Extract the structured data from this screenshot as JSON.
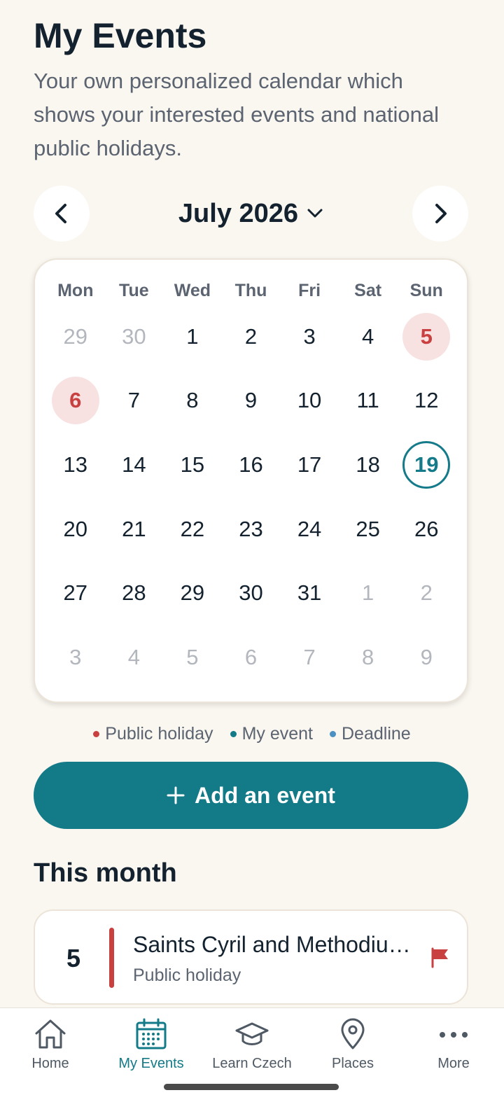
{
  "header": {
    "title": "My Events",
    "subtitle": "Your own personalized calendar which shows your interested events and national public holidays."
  },
  "calendar": {
    "month_label": "July 2026",
    "weekdays": [
      "Mon",
      "Tue",
      "Wed",
      "Thu",
      "Fri",
      "Sat",
      "Sun"
    ],
    "days": [
      {
        "label": "29",
        "state": "muted"
      },
      {
        "label": "30",
        "state": "muted"
      },
      {
        "label": "1",
        "state": ""
      },
      {
        "label": "2",
        "state": ""
      },
      {
        "label": "3",
        "state": ""
      },
      {
        "label": "4",
        "state": ""
      },
      {
        "label": "5",
        "state": "holiday"
      },
      {
        "label": "6",
        "state": "holiday"
      },
      {
        "label": "7",
        "state": ""
      },
      {
        "label": "8",
        "state": ""
      },
      {
        "label": "9",
        "state": ""
      },
      {
        "label": "10",
        "state": ""
      },
      {
        "label": "11",
        "state": ""
      },
      {
        "label": "12",
        "state": ""
      },
      {
        "label": "13",
        "state": ""
      },
      {
        "label": "14",
        "state": ""
      },
      {
        "label": "15",
        "state": ""
      },
      {
        "label": "16",
        "state": ""
      },
      {
        "label": "17",
        "state": ""
      },
      {
        "label": "18",
        "state": ""
      },
      {
        "label": "19",
        "state": "today"
      },
      {
        "label": "20",
        "state": ""
      },
      {
        "label": "21",
        "state": ""
      },
      {
        "label": "22",
        "state": ""
      },
      {
        "label": "23",
        "state": ""
      },
      {
        "label": "24",
        "state": ""
      },
      {
        "label": "25",
        "state": ""
      },
      {
        "label": "26",
        "state": ""
      },
      {
        "label": "27",
        "state": ""
      },
      {
        "label": "28",
        "state": ""
      },
      {
        "label": "29",
        "state": ""
      },
      {
        "label": "30",
        "state": ""
      },
      {
        "label": "31",
        "state": ""
      },
      {
        "label": "1",
        "state": "muted"
      },
      {
        "label": "2",
        "state": "muted"
      },
      {
        "label": "3",
        "state": "muted"
      },
      {
        "label": "4",
        "state": "muted"
      },
      {
        "label": "5",
        "state": "muted"
      },
      {
        "label": "6",
        "state": "muted"
      },
      {
        "label": "7",
        "state": "muted"
      },
      {
        "label": "8",
        "state": "muted"
      },
      {
        "label": "9",
        "state": "muted"
      }
    ]
  },
  "legend": [
    {
      "label": "Public holiday",
      "color": "#C94040"
    },
    {
      "label": "My event",
      "color": "#137A88"
    },
    {
      "label": "Deadline",
      "color": "#4A90C2"
    }
  ],
  "add_button": {
    "icon": "plus-icon",
    "label": "Add an event"
  },
  "this_month": {
    "title": "This month",
    "events": [
      {
        "day": "5",
        "title": "Saints Cyril and Methodius Day",
        "type": "Public holiday",
        "icon": "flag-icon",
        "color": "#C94040"
      }
    ]
  },
  "bottom_nav": {
    "items": [
      {
        "label": "Home",
        "icon": "home-icon"
      },
      {
        "label": "My Events",
        "icon": "calendar-icon",
        "active": true
      },
      {
        "label": "Learn Czech",
        "icon": "graduation-cap-icon"
      },
      {
        "label": "Places",
        "icon": "map-pin-icon"
      },
      {
        "label": "More",
        "icon": "more-icon"
      }
    ]
  },
  "colors": {
    "accent": "#137A88",
    "holiday": "#C94040",
    "background": "#FAF6F0"
  }
}
